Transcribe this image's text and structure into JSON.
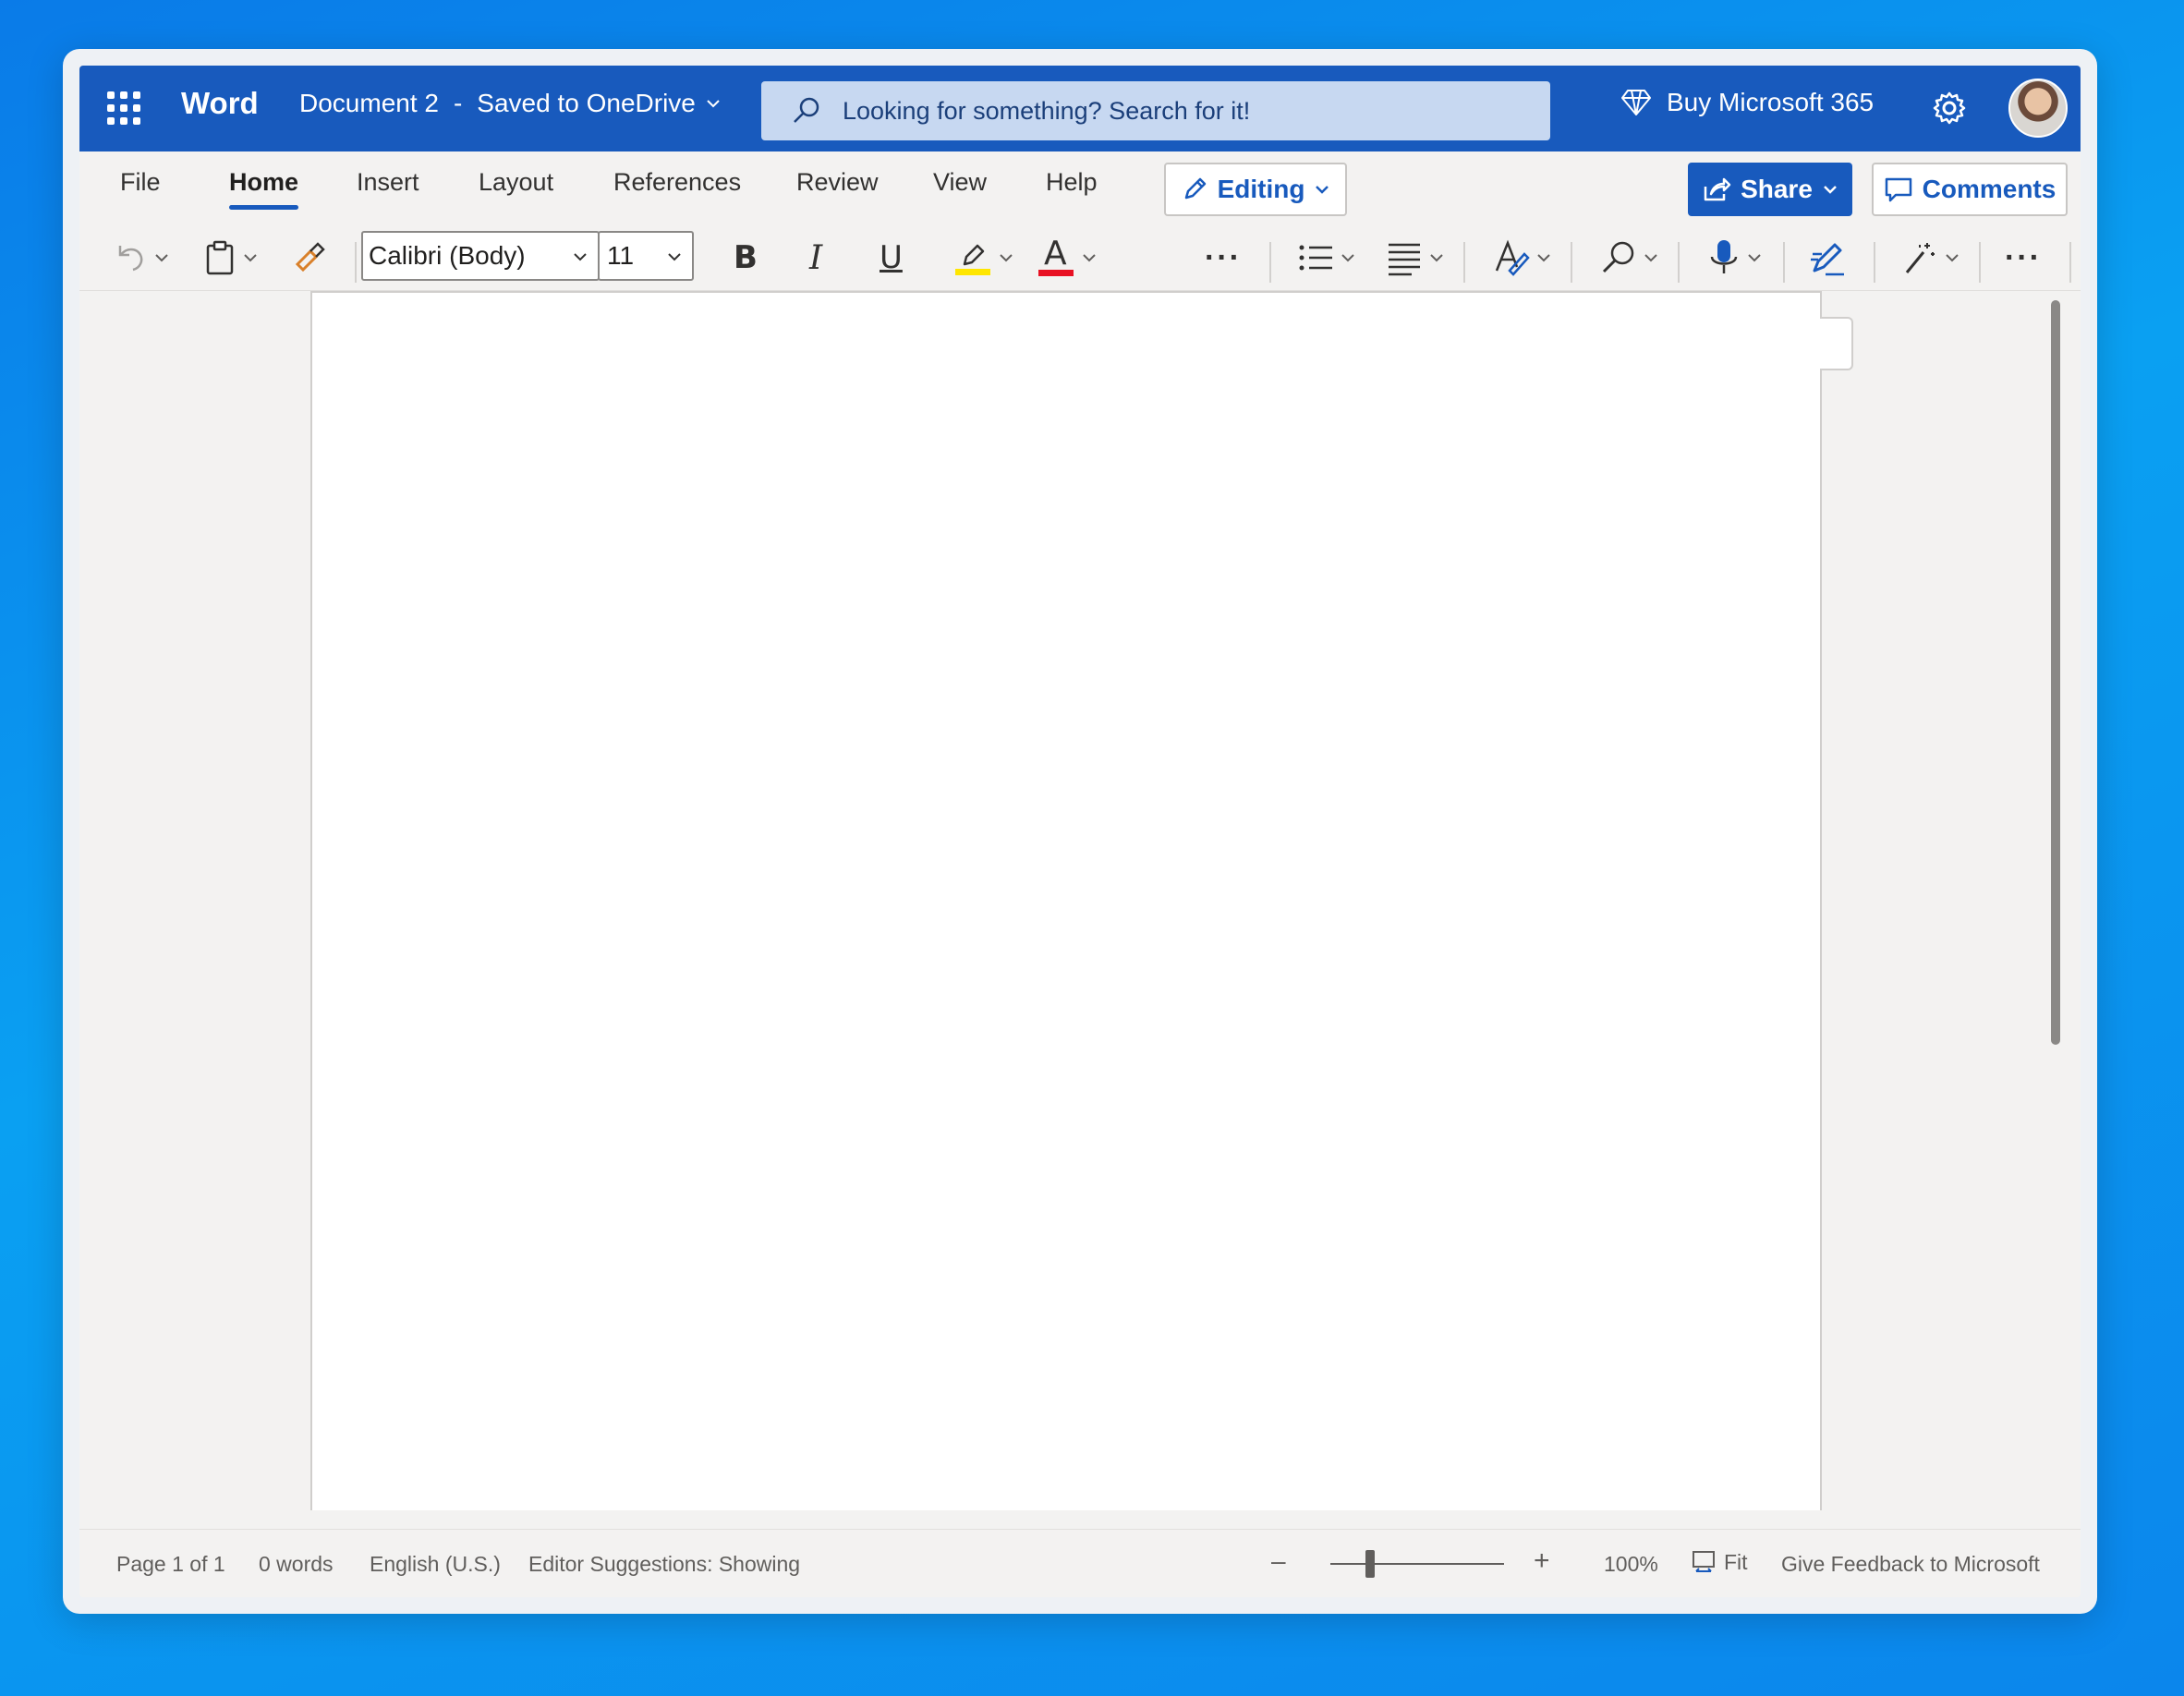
{
  "app": {
    "brand": "Word",
    "document_title": "Document 2",
    "separator": "-",
    "save_status": "Saved to OneDrive",
    "search_placeholder": "Looking for something? Search for it!",
    "buy_label": "Buy Microsoft 365",
    "accent_color": "#185abd"
  },
  "tabs": [
    "File",
    "Home",
    "Insert",
    "Layout",
    "References",
    "Review",
    "View",
    "Help"
  ],
  "active_tab": "Home",
  "ribbon_buttons": {
    "editing": "Editing",
    "share": "Share",
    "comments": "Comments"
  },
  "toolbar": {
    "font_name": "Calibri (Body)",
    "font_size": "11",
    "bold": "B",
    "italic": "I",
    "underline": "U",
    "font_color_letter": "A",
    "more": "···",
    "highlight_color": "#ffe600",
    "font_color": "#e81123",
    "icons": [
      "undo-icon",
      "clipboard-icon",
      "format-painter-icon",
      "highlighter-icon",
      "font-color-icon",
      "bullets-icon",
      "align-icon",
      "styles-icon",
      "find-icon",
      "dictate-icon",
      "editor-icon",
      "designer-icon",
      "more-icon"
    ]
  },
  "status": {
    "page": "Page 1 of 1",
    "words": "0 words",
    "language": "English (U.S.)",
    "editor": "Editor Suggestions: Showing",
    "zoom_minus": "–",
    "zoom_plus": "+",
    "zoom": "100%",
    "fit": "Fit",
    "feedback": "Give Feedback to Microsoft"
  }
}
